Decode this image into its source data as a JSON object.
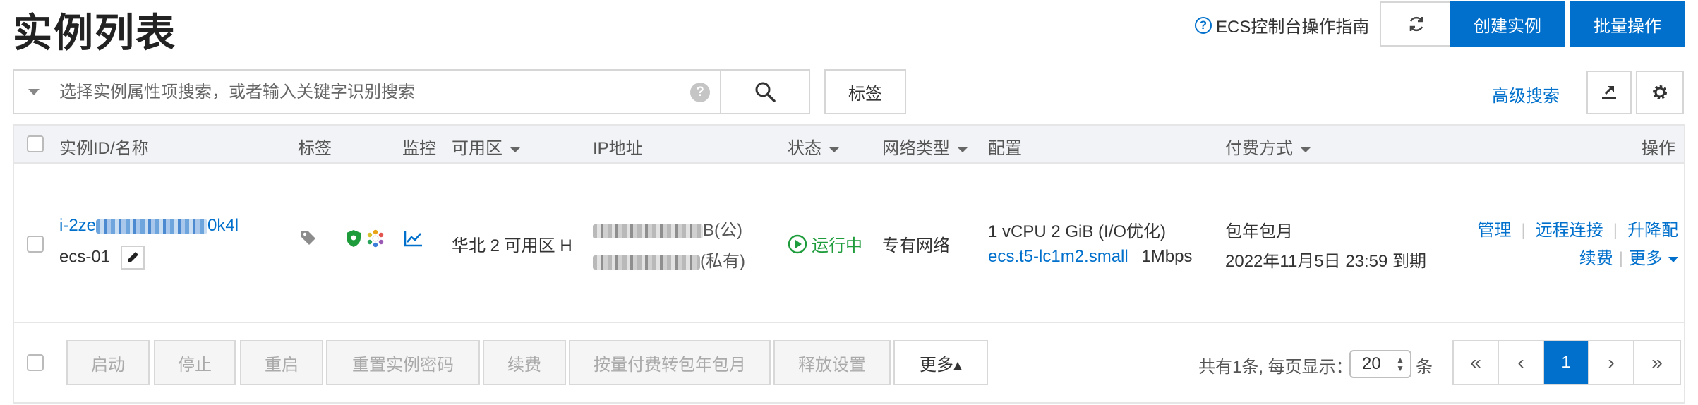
{
  "page": {
    "title": "实例列表",
    "guide_label": "ECS控制台操作指南",
    "guide_icon": "help-circle-icon",
    "create_label": "创建实例",
    "batch_label": "批量操作",
    "refresh_icon": "refresh-icon"
  },
  "search": {
    "placeholder": "选择实例属性项搜索，或者输入关键字识别搜索",
    "value": "",
    "help_icon": "question-mark-icon",
    "search_icon": "search-icon",
    "tag_label": "标签",
    "advanced_label": "高级搜索",
    "export_icon": "export-icon",
    "settings_icon": "gear-icon"
  },
  "table": {
    "columns": [
      "实例ID/名称",
      "标签",
      "监控",
      "可用区",
      "IP地址",
      "状态",
      "网络类型",
      "配置",
      "付费方式",
      "操作"
    ],
    "rows": [
      {
        "id_prefix": "i-2ze",
        "id_suffix": "0k4l",
        "name": "ecs-01",
        "zone": "华北 2 可用区 H",
        "ip_public_suffix": "B(公)",
        "ip_private_suffix": "(私有)",
        "status": "运行中",
        "network": "专有网络",
        "config_line1": "1 vCPU 2 GiB (I/O优化)",
        "config_type": "ecs.t5-lc1m2.small",
        "config_bandwidth": "1Mbps",
        "pay_type": "包年包月",
        "expire": "2022年11月5日 23:59 到期",
        "actions": {
          "manage": "管理",
          "remote": "远程连接",
          "upgrade": "升降配",
          "renew": "续费",
          "more": "更多"
        }
      }
    ]
  },
  "footer": {
    "buttons": [
      "启动",
      "停止",
      "重启",
      "重置实例密码",
      "续费",
      "按量付费转包年包月",
      "释放设置"
    ],
    "more_label": "更多▴",
    "total_text": "共有1条, 每页显示：",
    "page_size": "20",
    "unit": "条",
    "pager": [
      "«",
      "‹",
      "1",
      "›",
      "»"
    ],
    "current_page": "1"
  },
  "colors": {
    "accent": "#0070cc",
    "running": "#1e9c3c",
    "header_bg": "#f2f3f6"
  }
}
